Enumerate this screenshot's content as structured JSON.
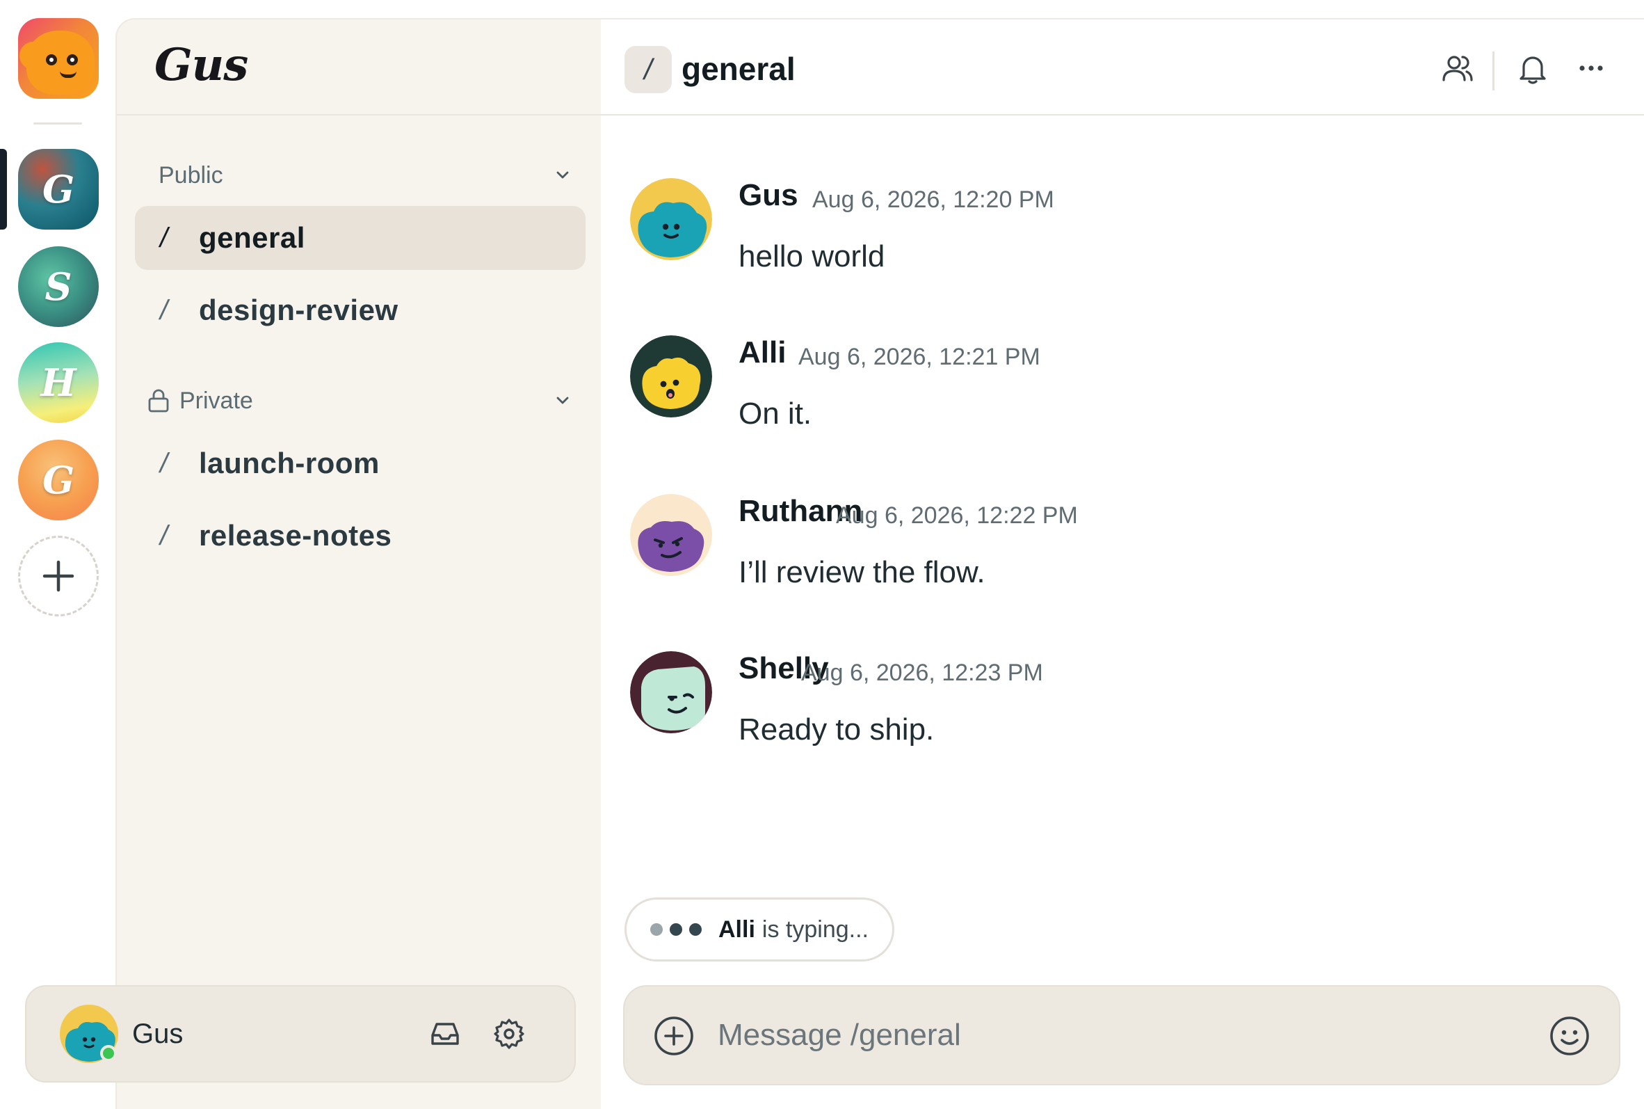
{
  "workspace": {
    "name": "Gus"
  },
  "servers": [
    {
      "letter": "G",
      "active": true
    },
    {
      "letter": "S"
    },
    {
      "letter": "H"
    },
    {
      "letter": "G"
    }
  ],
  "rail": {
    "logo_icon": "app-logo-icon",
    "add_icon": "plus-icon"
  },
  "sections": {
    "public": {
      "label": "Public",
      "channels": [
        {
          "name": "general",
          "active": true
        },
        {
          "name": "design-review"
        }
      ]
    },
    "private": {
      "label": "Private",
      "channels": [
        {
          "name": "launch-room"
        },
        {
          "name": "release-notes"
        }
      ]
    }
  },
  "channel_prefix": "/",
  "current_user": {
    "name": "Gus",
    "status": "online",
    "status_color": "#3cc553"
  },
  "header": {
    "channel": "general",
    "icons": [
      "members-icon",
      "bell-icon",
      "more-icon"
    ]
  },
  "messages": [
    {
      "author": "Gus",
      "time": "Aug 6, 2026, 12:20 PM",
      "text": "hello world"
    },
    {
      "author": "Alli",
      "time": "Aug 6, 2026, 12:21 PM",
      "text": "On it."
    },
    {
      "author": "Ruthann",
      "time": "Aug 6, 2026, 12:22 PM",
      "text": "I’ll review the flow."
    },
    {
      "author": "Shelly",
      "time": "Aug 6, 2026, 12:23 PM",
      "text": "Ready to ship."
    }
  ],
  "typing": {
    "who": "Alli",
    "rest": "is typing..."
  },
  "composer": {
    "placeholder": "Message /general"
  },
  "colors": {
    "sidebar_bg": "#f7f4ee",
    "active_channel_bg": "#e8e2d9",
    "composer_bg": "#ede8e0",
    "text_primary": "#131c20",
    "text_muted": "#5f6c72"
  }
}
